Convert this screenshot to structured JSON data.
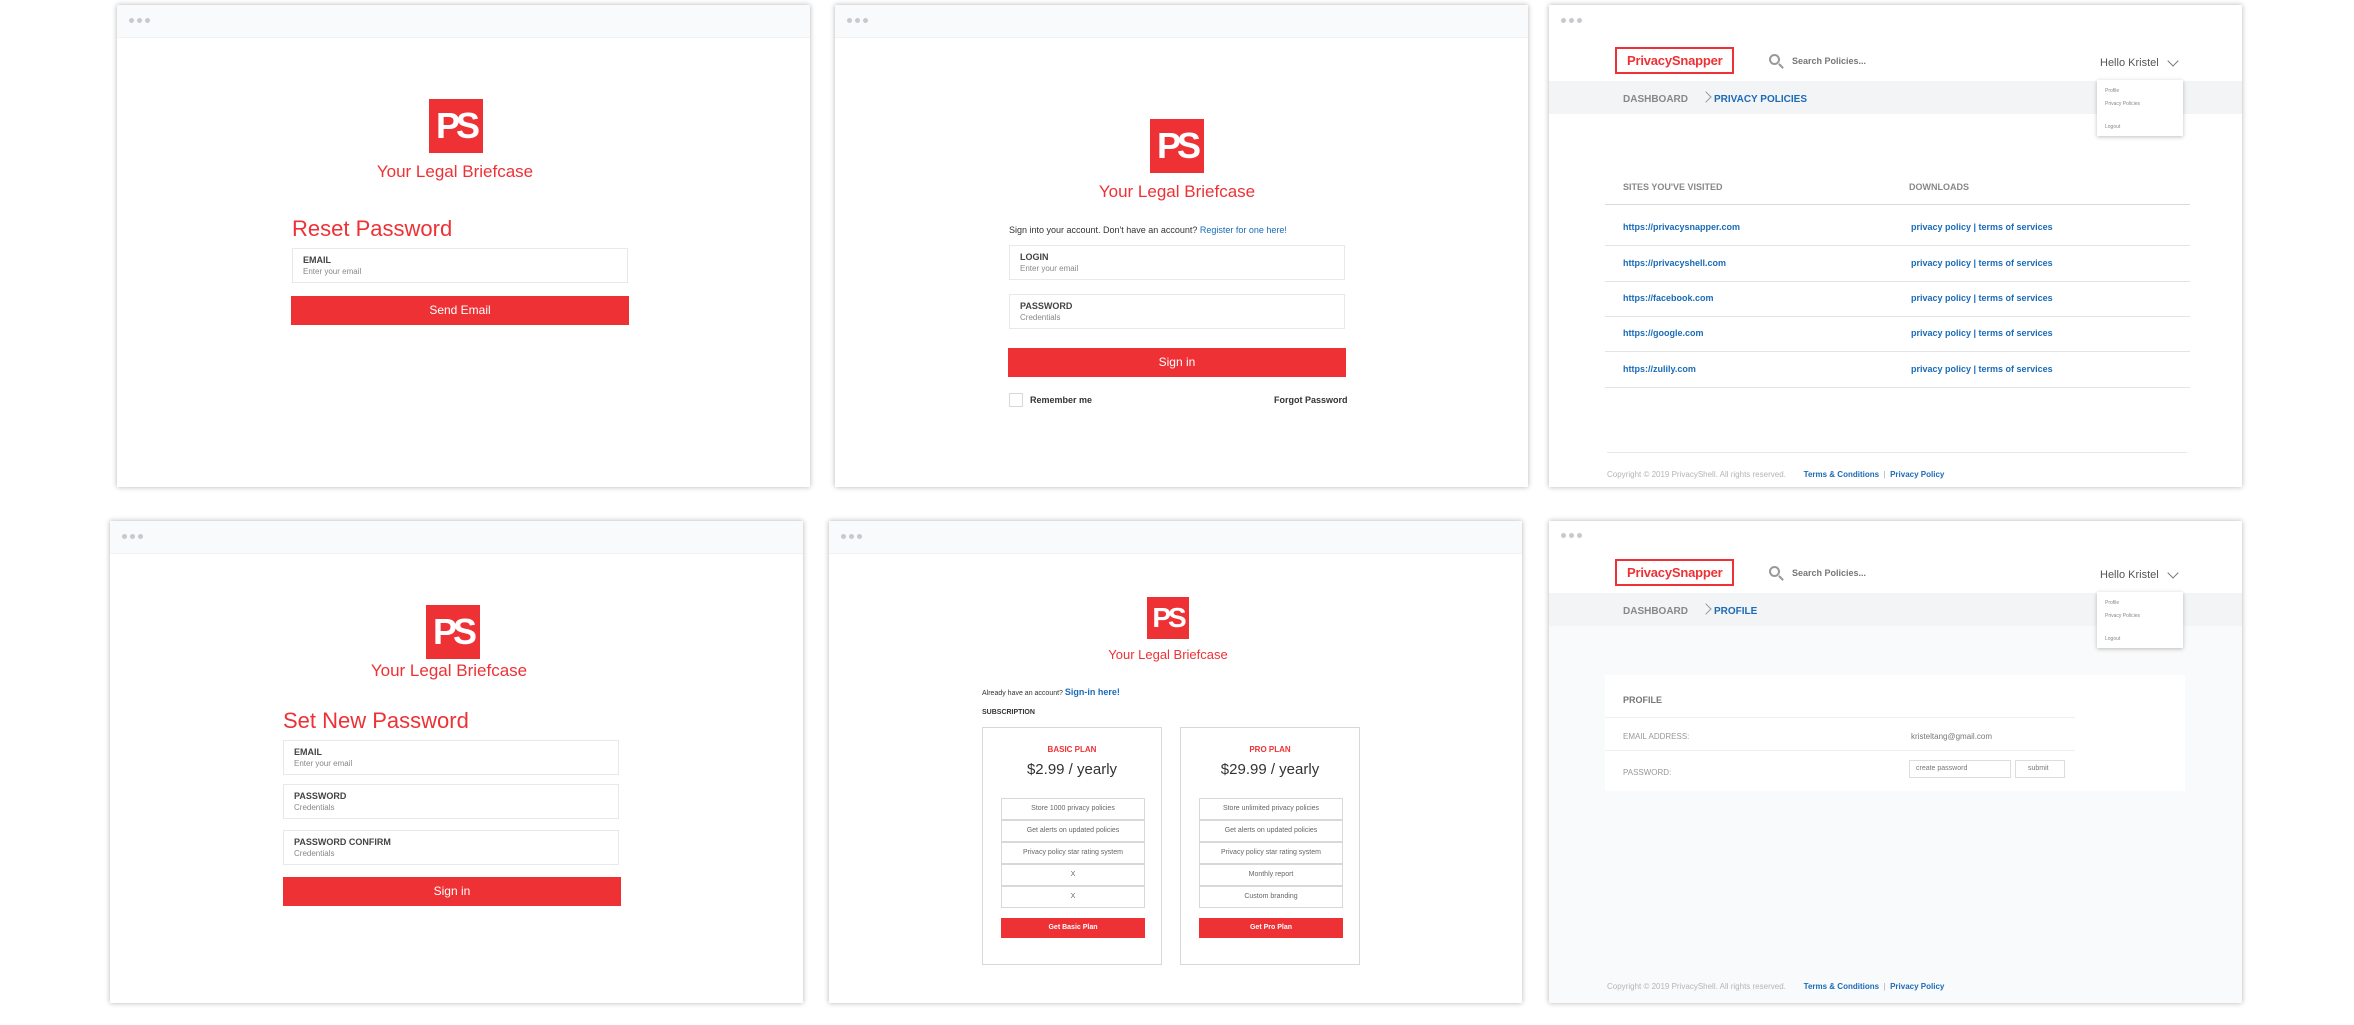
{
  "logo_text": "PS",
  "tagline": "Your Legal Briefcase",
  "reset": {
    "title": "Reset Password",
    "email_label": "EMAIL",
    "email_placeholder": "Enter your email",
    "button": "Send Email"
  },
  "signin": {
    "prompt": "Sign into your account. Don't have an account?",
    "register_link": "Register for one here!",
    "login_label": "LOGIN",
    "login_placeholder": "Enter your email",
    "password_label": "PASSWORD",
    "password_placeholder": "Credentials",
    "button": "Sign in",
    "remember": "Remember me",
    "forgot": "Forgot Password"
  },
  "header": {
    "brand": "PrivacySnapper",
    "search_placeholder": "Search Policies...",
    "greeting": "Hello Kristel",
    "dropdown": [
      "Profile",
      "Privacy Policies",
      "Logout"
    ]
  },
  "policies": {
    "breadcrumb_root": "DASHBOARD",
    "breadcrumb_current": "PRIVACY POLICIES",
    "col_sites": "SITES YOU'VE VISITED",
    "col_downloads": "DOWNLOADS",
    "rows": [
      {
        "site": "https://privacysnapper.com",
        "download": "privacy policy | terms of services"
      },
      {
        "site": "https://privacyshell.com",
        "download": "privacy policy | terms of services"
      },
      {
        "site": "https://facebook.com",
        "download": "privacy policy | terms of services"
      },
      {
        "site": "https://google.com",
        "download": "privacy policy | terms of services"
      },
      {
        "site": "https://zulily.com",
        "download": "privacy policy | terms of services"
      }
    ]
  },
  "footer": {
    "copyright": "Copyright © 2019 PrivacyShell. All rights reserved.",
    "terms": "Terms & Conditions",
    "privacy": "Privacy Policy"
  },
  "setpw": {
    "title": "Set New Password",
    "email_label": "EMAIL",
    "email_placeholder": "Enter your email",
    "password_label": "PASSWORD",
    "password_placeholder": "Credentials",
    "confirm_label": "PASSWORD CONFIRM",
    "confirm_placeholder": "Credentials",
    "button": "Sign in"
  },
  "subscribe": {
    "prompt": "Already have an account?",
    "signin_link": "Sign-in here!",
    "section": "SUBSCRIPTION",
    "plans": [
      {
        "name": "BASIC PLAN",
        "price": "$2.99 / yearly",
        "features": [
          "Store 1000 privacy policies",
          "Get alerts on updated policies",
          "Privacy policy star rating system",
          "X",
          "X"
        ],
        "button": "Get Basic Plan"
      },
      {
        "name": "PRO PLAN",
        "price": "$29.99 / yearly",
        "features": [
          "Store unlimited privacy policies",
          "Get alerts on updated policies",
          "Privacy policy star rating system",
          "Monthly report",
          "Custom branding"
        ],
        "button": "Get Pro Plan"
      }
    ]
  },
  "profile": {
    "breadcrumb_root": "DASHBOARD",
    "breadcrumb_current": "PROFILE",
    "title": "PROFILE",
    "email_label": "EMAIL ADDRESS:",
    "email_value": "kristeltang@gmail.com",
    "password_label": "PASSWORD:",
    "password_placeholder": "create password",
    "submit": "submit"
  },
  "colors": {
    "brand_red": "#ee3135",
    "link_blue": "#1a6bb8"
  }
}
